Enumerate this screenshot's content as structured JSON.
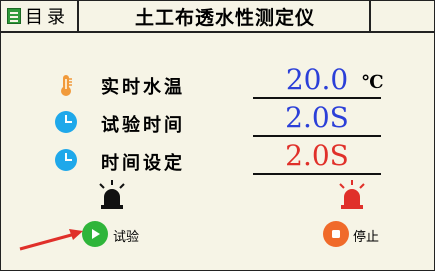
{
  "header": {
    "menu_label": "目录",
    "title": "土工布透水性测定仪"
  },
  "readings": [
    {
      "label": "实时水温",
      "value": "20.0",
      "unit": "℃",
      "icon": "thermometer-icon",
      "color": "#2b3fd8"
    },
    {
      "label": "试验时间",
      "value": "2.0S",
      "icon": "clock-icon",
      "color": "#2b3fd8"
    },
    {
      "label": "时间设定",
      "value": "2.0S",
      "icon": "clock-icon",
      "color": "#e0302a"
    }
  ],
  "controls": {
    "start_label": "试验",
    "stop_label": "停止",
    "start_icon": "play-icon",
    "stop_icon": "stop-icon",
    "start_alarm_icon": "alarm-light-off-icon",
    "stop_alarm_icon": "alarm-light-on-icon"
  },
  "colors": {
    "start_button": "#2fb53a",
    "stop_button": "#f06a2a",
    "alarm_on": "#e0302a",
    "alarm_off": "#111111",
    "pointer_arrow": "#e0302a"
  }
}
